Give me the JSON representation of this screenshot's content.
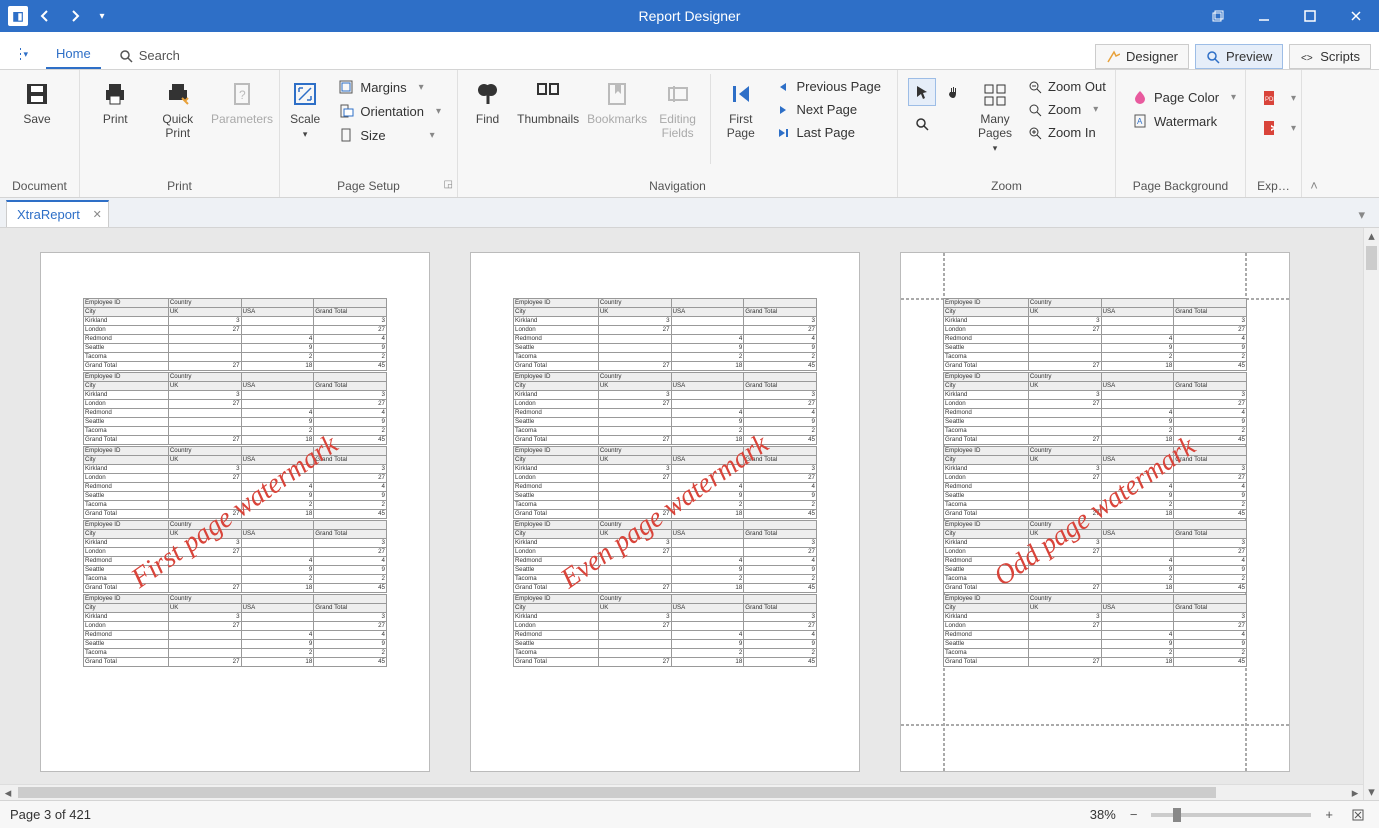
{
  "titlebar": {
    "title": "Report Designer"
  },
  "ribbonTabs": {
    "home": "Home",
    "search": "Search",
    "designer": "Designer",
    "preview": "Preview",
    "scripts": "Scripts"
  },
  "ribbon": {
    "document": {
      "label": "Document",
      "save": "Save"
    },
    "print": {
      "label": "Print",
      "print": "Print",
      "quickPrint": "Quick Print",
      "parameters": "Parameters"
    },
    "pageSetup": {
      "label": "Page Setup",
      "scale": "Scale",
      "margins": "Margins",
      "orientation": "Orientation",
      "size": "Size"
    },
    "navigation": {
      "label": "Navigation",
      "find": "Find",
      "thumbnails": "Thumbnails",
      "bookmarks": "Bookmarks",
      "editingFields": "Editing Fields",
      "firstPage": "First Page",
      "previousPage": "Previous Page",
      "nextPage": "Next  Page",
      "lastPage": "Last  Page"
    },
    "zoom": {
      "label": "Zoom",
      "manyPages": "Many Pages",
      "zoomOut": "Zoom Out",
      "zoom": "Zoom",
      "zoomIn": "Zoom In"
    },
    "pageBg": {
      "label": "Page Background",
      "pageColor": "Page Color",
      "watermark": "Watermark"
    },
    "export": {
      "label": "Exp…"
    }
  },
  "docTabs": {
    "name": "XtraReport"
  },
  "pages": {
    "watermark1": "First page watermark",
    "watermark2": "Even page watermark",
    "watermark3": "Odd page watermark"
  },
  "tableBlock": {
    "headerRow": [
      "Employee ID",
      "Country",
      "",
      ""
    ],
    "subHeaderRow": [
      "City",
      "UK",
      "USA",
      "Grand Total"
    ],
    "rows": [
      [
        "Kirkland",
        "3",
        "",
        "3"
      ],
      [
        "London",
        "27",
        "",
        "27"
      ],
      [
        "Redmond",
        "",
        "4",
        "4"
      ],
      [
        "Seattle",
        "",
        "9",
        "9"
      ],
      [
        "Tacoma",
        "",
        "2",
        "2"
      ],
      [
        "Grand Total",
        "27",
        "18",
        "45"
      ]
    ]
  },
  "statusbar": {
    "pageInfo": "Page 3 of 421",
    "zoom": "38%"
  }
}
